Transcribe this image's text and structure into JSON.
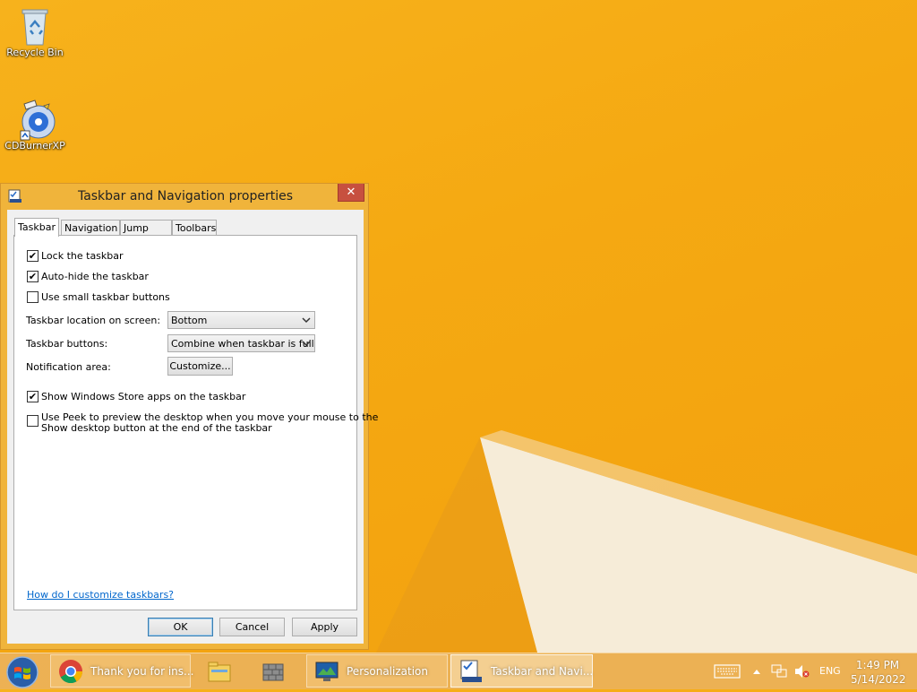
{
  "desktop": {
    "icons": [
      {
        "label": "Recycle Bin",
        "icon": "recycle-bin-icon"
      },
      {
        "label": "CDBurnerXP",
        "icon": "cdburner-icon"
      }
    ]
  },
  "dialog": {
    "title": "Taskbar and Navigation properties",
    "close_label": "✕",
    "tabs": [
      {
        "label": "Taskbar",
        "active": true
      },
      {
        "label": "Navigation",
        "active": false
      },
      {
        "label": "Jump Lists",
        "active": false
      },
      {
        "label": "Toolbars",
        "active": false
      }
    ],
    "options": {
      "lock": {
        "label": "Lock the taskbar",
        "checked": true
      },
      "autohide": {
        "label": "Auto-hide the taskbar",
        "checked": true
      },
      "small": {
        "label": "Use small taskbar buttons",
        "checked": false
      },
      "store_apps": {
        "label": "Show Windows Store apps on the taskbar",
        "checked": true
      },
      "peek": {
        "label_line1": "Use Peek to preview the desktop when you move your mouse to the",
        "label_line2": "Show desktop button at the end of the taskbar",
        "checked": false
      }
    },
    "location": {
      "label": "Taskbar location on screen:",
      "value": "Bottom"
    },
    "buttons": {
      "label": "Taskbar buttons:",
      "value": "Combine when taskbar is full"
    },
    "notification": {
      "label": "Notification area:",
      "button": "Customize..."
    },
    "help_link": "How do I customize taskbars?",
    "footer": {
      "ok": "OK",
      "cancel": "Cancel",
      "apply": "Apply"
    }
  },
  "taskbar": {
    "items": [
      {
        "label": "Thank you for ins...",
        "icon": "chrome-icon"
      },
      {
        "label": "",
        "icon": "file-explorer-icon"
      },
      {
        "label": "",
        "icon": "firewall-icon"
      },
      {
        "label": "Personalization",
        "icon": "personalization-icon"
      },
      {
        "label": "Taskbar and Navi...",
        "icon": "taskbar-properties-icon"
      }
    ],
    "tray": {
      "language": "ENG",
      "time": "1:49 PM",
      "date": "5/14/2022"
    }
  },
  "colors": {
    "wallpaper": "#f5a912",
    "dialog_frame": "#f0b43b",
    "close_button": "#c7503f",
    "link": "#0066cc"
  }
}
